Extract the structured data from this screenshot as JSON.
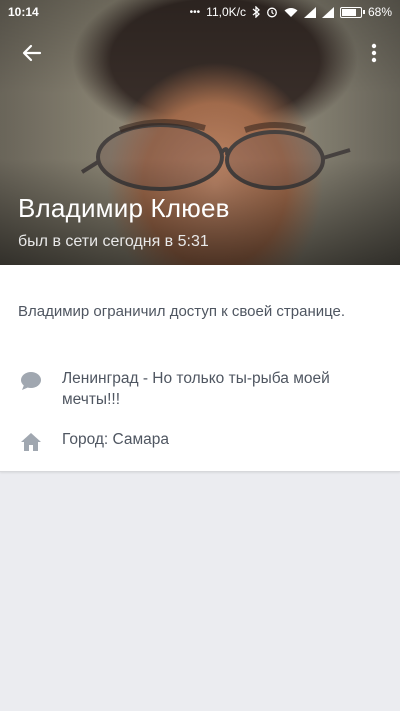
{
  "status_bar": {
    "time": "10:14",
    "net_speed": "11,0K/c",
    "battery": "68%",
    "battery_level": 0.68
  },
  "profile": {
    "name": "Владимир Клюев",
    "last_seen": "был в сети сегодня в 5:31"
  },
  "content": {
    "restricted_text": "Владимир ограничил доступ к своей странице.",
    "status_text": "Ленинград - Но только ты-рыба моей мечты!!!",
    "city_text": "Город: Самара"
  },
  "icons": {
    "back": "arrow-back-icon",
    "menu": "more-vert-icon",
    "status": "chat-bubble-icon",
    "city": "home-icon"
  },
  "colors": {
    "text": "#4f5661",
    "icon": "#a0a7b0",
    "background": "#ebecf0"
  }
}
